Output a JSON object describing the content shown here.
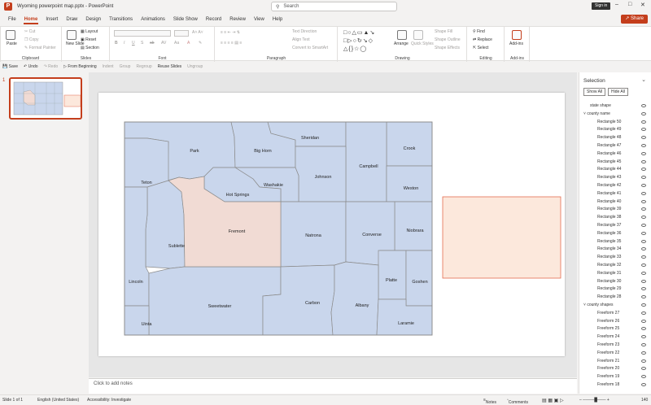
{
  "window": {
    "title": "Wyoming powerpoint map.pptx  -  PowerPoint",
    "app_initial": "P",
    "signin": "Sign in"
  },
  "search": {
    "placeholder": "Search"
  },
  "menu": {
    "items": [
      "File",
      "Home",
      "Insert",
      "Draw",
      "Design",
      "Transitions",
      "Animations",
      "Slide Show",
      "Record",
      "Review",
      "View",
      "Help"
    ],
    "active": "Home",
    "share": "Share"
  },
  "ribbon": {
    "clipboard": {
      "label": "Clipboard",
      "paste": "Paste",
      "cut": "Cut",
      "copy": "Copy",
      "format_painter": "Format Painter"
    },
    "slides": {
      "label": "Slides",
      "new_slide": "New Slide",
      "layout": "Layout",
      "reset": "Reset",
      "section": "Section"
    },
    "font": {
      "label": "Font"
    },
    "paragraph": {
      "label": "Paragraph",
      "text_direction": "Text Direction",
      "align_text": "Align Text",
      "smartart": "Convert to SmartArt"
    },
    "drawing": {
      "label": "Drawing",
      "arrange": "Arrange",
      "quick_styles": "Quick Styles",
      "shape_fill": "Shape Fill",
      "shape_outline": "Shape Outline",
      "shape_effects": "Shape Effects"
    },
    "editing": {
      "label": "Editing",
      "find": "Find",
      "replace": "Replace",
      "select": "Select"
    },
    "addins": {
      "label": "Add-ins",
      "addins": "Add-ins"
    }
  },
  "qat": {
    "save": "Save",
    "undo": "Undo",
    "redo": "Redo",
    "from_beginning": "From Beginning",
    "indent": "Indent",
    "group": "Group",
    "regroup": "Regroup",
    "reuse_slides": "Reuse Slides",
    "ungroup": "Ungroup"
  },
  "slide_number": "1",
  "map": {
    "counties": [
      "Park",
      "Big Horn",
      "Sheridan",
      "Crook",
      "Campbell",
      "Johnson",
      "Teton",
      "Washakie",
      "Weston",
      "Hot Springs",
      "Fremont",
      "Niobrara",
      "Natrona",
      "Converse",
      "Sublette",
      "Lincoln",
      "Platte",
      "Goshen",
      "Sweetwater",
      "Carbon",
      "Albany",
      "Uinta",
      "Laramie"
    ],
    "colors": {
      "county_fill": "#c9d6ec",
      "highlight_fill": "#f1dbd4",
      "border": "#8c8c8c",
      "box_fill": "#fce8dc",
      "box_border": "#e36b50"
    }
  },
  "notes": {
    "placeholder": "Click to add notes"
  },
  "selection_pane": {
    "title": "Selection",
    "show_all": "Show All",
    "hide_all": "Hide All",
    "state_shape": "state shape",
    "group1": "county name",
    "rectangles": [
      "Rectangle 50",
      "Rectangle 49",
      "Rectangle 48",
      "Rectangle 47",
      "Rectangle 46",
      "Rectangle 45",
      "Rectangle 44",
      "Rectangle 43",
      "Rectangle 42",
      "Rectangle 41",
      "Rectangle 40",
      "Rectangle 39",
      "Rectangle 38",
      "Rectangle 37",
      "Rectangle 36",
      "Rectangle 35",
      "Rectangle 34",
      "Rectangle 33",
      "Rectangle 32",
      "Rectangle 31",
      "Rectangle 30",
      "Rectangle 29",
      "Rectangle 28"
    ],
    "group2": "county shapes",
    "freeforms": [
      "Freeform 27",
      "Freeform 26",
      "Freeform 25",
      "Freeform 24",
      "Freeform 23",
      "Freeform 22",
      "Freeform 21",
      "Freeform 20",
      "Freeform 19",
      "Freeform 18"
    ]
  },
  "status": {
    "slide": "Slide 1 of 1",
    "language": "English (United States)",
    "accessibility": "Accessibility: Investigate",
    "notes": "Notes",
    "comments": "Comments",
    "zoom": "140"
  }
}
